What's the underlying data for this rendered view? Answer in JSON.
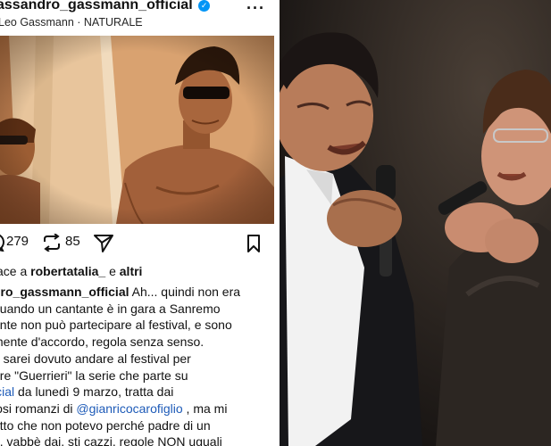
{
  "post": {
    "username": "assandro_gassmann_official",
    "subtitle": "Leo Gassmann · NATURALE",
    "likes_count": "279",
    "reposts_count": "85"
  },
  "likes_line": {
    "prefix": "ace a ",
    "user": "robertatalia_",
    "mid": " e ",
    "others": "altri"
  },
  "caption": {
    "author": "dro_gassmann_official",
    "l1_text": " Ah... quindi non era",
    "l2": "quando un cantante è in gara a Sanremo",
    "l3": "ante non può partecipare al festival, e sono",
    "l4": "mente d'accordo, regola senza senso.",
    "l5": "o sarei dovuto andare al festival per",
    "l6": "are \"Guerrieri\" la serie che parte su",
    "l7_link": "icial",
    "l7_text": " da lunedì 9 marzo, tratta dai",
    "l8_text": "iosi romanzi di ",
    "l8_link": "@gianricocarofiglio",
    "l8_end": " , ma mi",
    "l9": "etto che non potevo perché padre di un",
    "l10": "... vabbè dai, sti cazzi, regole NON uguali"
  },
  "colors": {
    "verified": "#0095f6",
    "link": "#1e5bb8"
  },
  "icons": [
    "verified-badge-icon",
    "more-options-icon",
    "sound-off-icon",
    "comment-icon",
    "repost-icon",
    "share-icon",
    "bookmark-icon"
  ]
}
